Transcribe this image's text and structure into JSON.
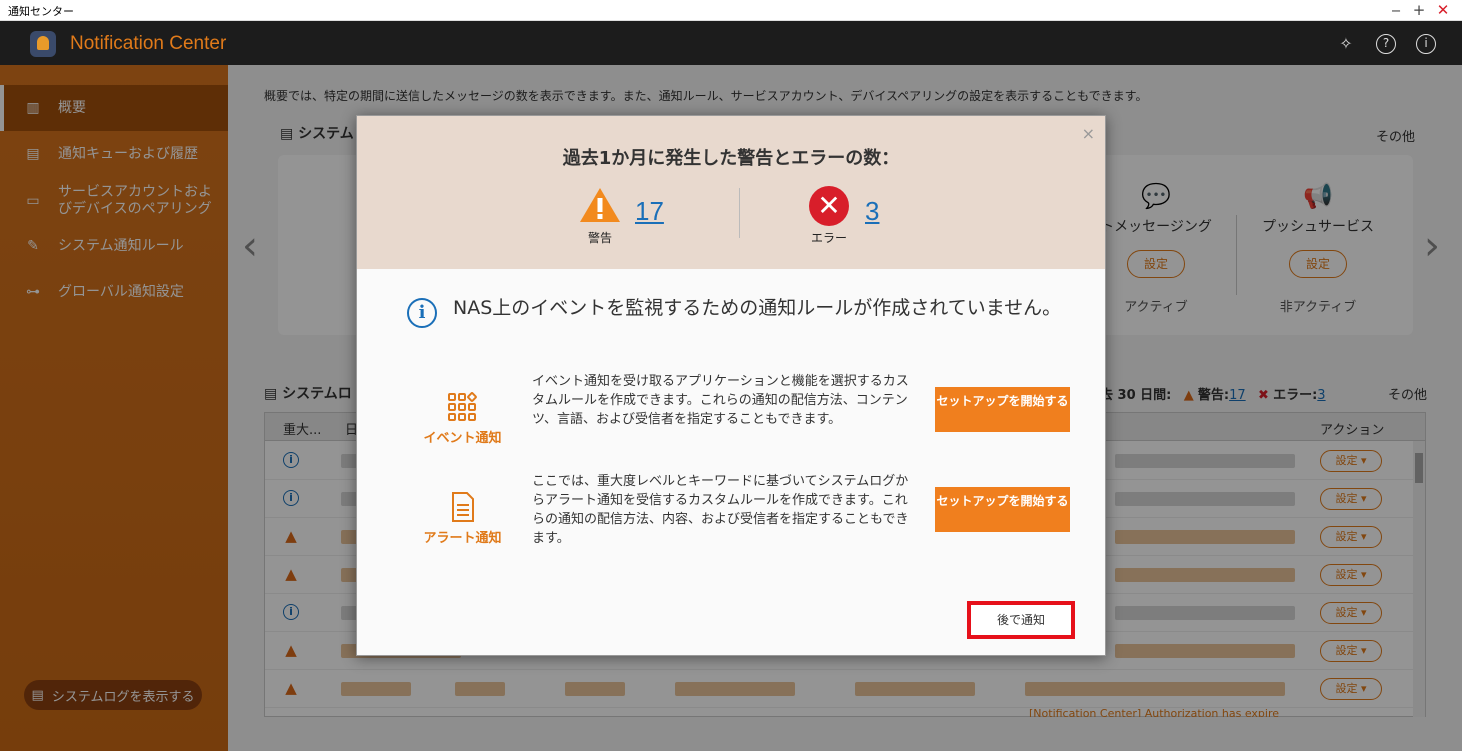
{
  "window": {
    "title": "通知センター",
    "controls": [
      "‒",
      "+",
      "✕"
    ]
  },
  "app": {
    "title": "Notification Center"
  },
  "header_icons": [
    "wand-icon",
    "help-icon",
    "info-icon"
  ],
  "sidebar": {
    "items": [
      {
        "label": "概要",
        "icon": "chart-icon",
        "active": true
      },
      {
        "label": "通知キューおよび履歴",
        "icon": "history-icon"
      },
      {
        "label": "サービスアカウントおよびデバイスのペアリング",
        "icon": "device-icon"
      },
      {
        "label": "システム通知ルール",
        "icon": "rule-icon"
      },
      {
        "label": "グローバル通知設定",
        "icon": "toggle-icon"
      }
    ],
    "log_button": "システムログを表示する"
  },
  "main": {
    "intro": "概要では、特定の期間に送信したメッセージの数を表示できます。また、通知ルール、サービスアカウント、デバイスペアリングの設定を表示することもできます。",
    "section1": "システム",
    "other": "その他",
    "services": [
      {
        "name": "トメッセージング",
        "button": "設定",
        "state": "アクティブ"
      },
      {
        "name": "プッシュサービス",
        "button": "設定",
        "state": "非アクティブ"
      }
    ],
    "section2": "システムロ",
    "log_summary": {
      "period": "去 30 日間:",
      "warn_label": "警告:",
      "warn_count": "17",
      "error_label": "エラー:",
      "error_count": "3",
      "other": "その他"
    },
    "table": {
      "columns": [
        "重大...",
        "日",
        "アクション"
      ],
      "rows": [
        {
          "severity": "info",
          "action": "設定 ▾"
        },
        {
          "severity": "info",
          "action": "設定 ▾"
        },
        {
          "severity": "warn",
          "action": "設定 ▾"
        },
        {
          "severity": "warn",
          "action": "設定 ▾"
        },
        {
          "severity": "info",
          "action": "設定 ▾"
        },
        {
          "severity": "warn",
          "action": "設定 ▾"
        },
        {
          "severity": "warn",
          "action": "設定 ▾"
        }
      ],
      "footer_text": "[Notification Center] Authorization has expire"
    }
  },
  "modal": {
    "close": "×",
    "title": "過去1か月に発生した警告とエラーの数：",
    "warnings": {
      "count": "17",
      "label": "警告"
    },
    "errors": {
      "count": "3",
      "label": "エラー"
    },
    "headline": "NAS上のイベントを監視するための通知ルールが作成されていません。",
    "features": [
      {
        "name": "イベント通知",
        "icon": "grid-icon",
        "description": "イベント通知を受け取るアプリケーションと機能を選択するカスタムルールを作成できます。これらの通知の配信方法、コンテンツ、言語、および受信者を指定することもできます。",
        "button": "セットアップを開始する"
      },
      {
        "name": "アラート通知",
        "icon": "document-icon",
        "description": "ここでは、重大度レベルとキーワードに基づいてシステムログからアラート通知を受信するカスタムルールを作成できます。これらの通知の配信方法、内容、および受信者を指定することもできます。",
        "button": "セットアップを開始する"
      }
    ],
    "later_button": "後で通知"
  }
}
